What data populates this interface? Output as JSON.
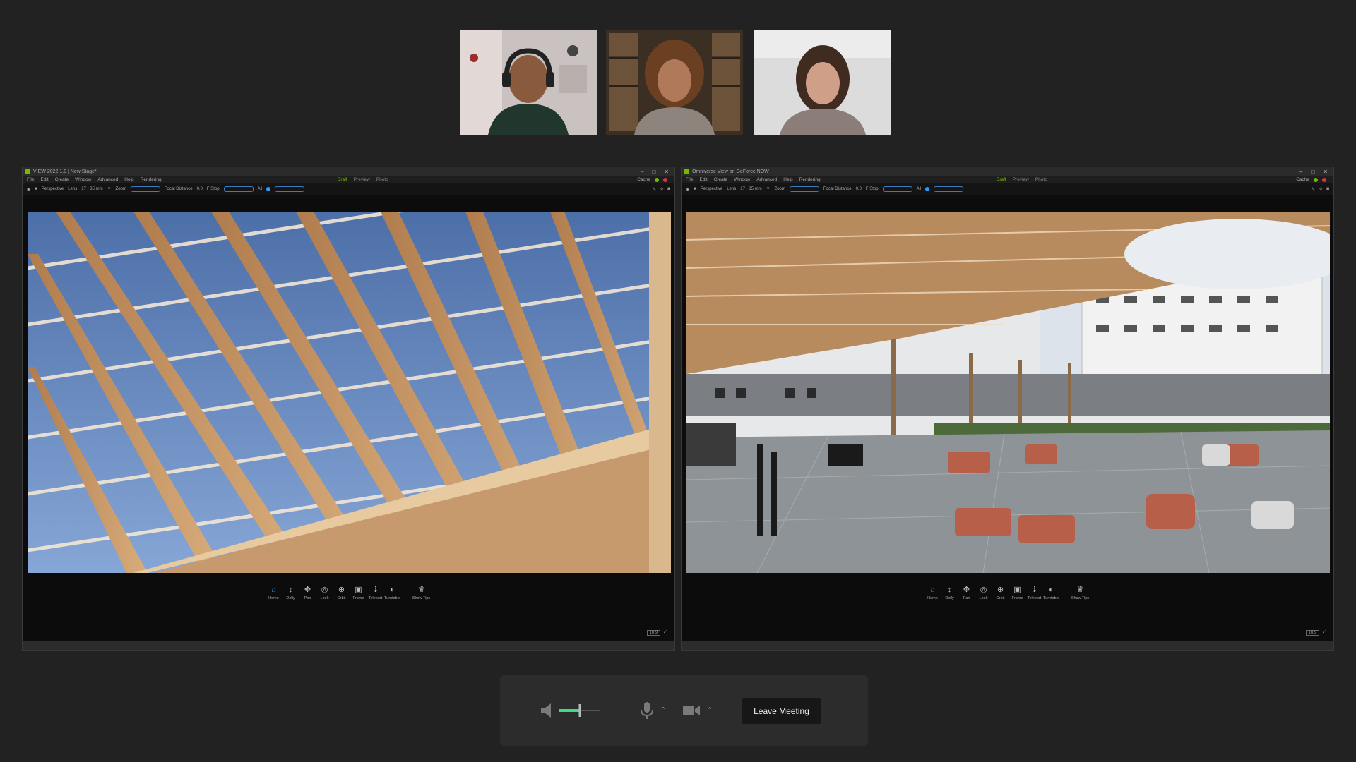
{
  "participants": [
    {
      "avatar": "participant-1-video"
    },
    {
      "avatar": "participant-2-video"
    },
    {
      "avatar": "participant-3-video"
    }
  ],
  "left_app": {
    "title": "VIEW  2022.1.0  |  New Stage*",
    "menus": [
      "File",
      "Edit",
      "Create",
      "Window",
      "Advanced",
      "Help",
      "Rendering"
    ],
    "modes": [
      "Draft",
      "Preview",
      "Photo"
    ],
    "cache_label": "Cache",
    "toolbar": {
      "camera": "Perspective",
      "lens_label": "Lens",
      "lens_value": "17 - 35 mm",
      "zoom_label": "Zoom",
      "focal_label": "Focal Distance",
      "focal_value": "0.0",
      "fstop_label": "F Stop",
      "all_label": "All"
    },
    "nav": [
      "Home",
      "Dolly",
      "Pan",
      "Look",
      "Orbit",
      "Frame",
      "Teleport",
      "Turntable",
      "Show Tips"
    ]
  },
  "right_app": {
    "title": "Omniverse View on GeForce NOW",
    "menus": [
      "File",
      "Edit",
      "Create",
      "Window",
      "Advanced",
      "Help",
      "Rendering"
    ],
    "modes": [
      "Draft",
      "Preview",
      "Photo"
    ],
    "cache_label": "Cache",
    "toolbar": {
      "camera": "Perspective",
      "lens_label": "Lens",
      "lens_value": "17 - 35 mm",
      "zoom_label": "Zoom",
      "focal_label": "Focal Distance",
      "focal_value": "0.0",
      "fstop_label": "F Stop",
      "all_label": "All"
    },
    "nav": [
      "Home",
      "Dolly",
      "Pan",
      "Look",
      "Orbit",
      "Frame",
      "Teleport",
      "Turntable",
      "Show Tips"
    ]
  },
  "controls": {
    "leave_label": "Leave Meeting",
    "volume_level": 0.5,
    "accent_color": "#3ddc84"
  }
}
